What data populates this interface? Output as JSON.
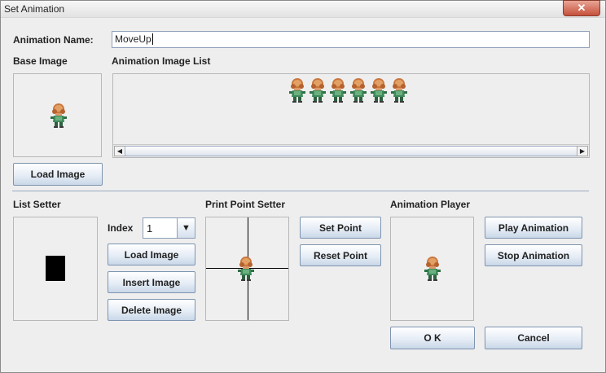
{
  "window": {
    "title": "Set Animation",
    "close_glyph": "✕"
  },
  "animation_name": {
    "label": "Animation Name:",
    "value": "MoveUp"
  },
  "base_image": {
    "label": "Base Image",
    "load_label": "Load Image"
  },
  "image_list": {
    "label": "Animation Image List",
    "frame_count": 6
  },
  "list_setter": {
    "label": "List Setter",
    "index_label": "Index",
    "index_value": "1",
    "load_label": "Load Image",
    "insert_label": "Insert Image",
    "delete_label": "Delete Image"
  },
  "print_point": {
    "label": "Print Point Setter",
    "set_label": "Set Point",
    "reset_label": "Reset Point"
  },
  "player": {
    "label": "Animation Player",
    "play_label": "Play Animation",
    "stop_label": "Stop Animation"
  },
  "dialog": {
    "ok_label": "O K",
    "cancel_label": "Cancel"
  },
  "colors": {
    "button_border": "#7e94b0",
    "sprite_hair": "#c9773e",
    "sprite_body": "#3e8a5a",
    "separator": "#9aaac0"
  }
}
